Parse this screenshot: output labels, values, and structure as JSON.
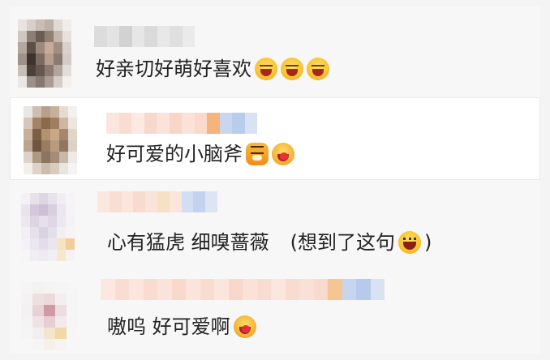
{
  "comments": [
    {
      "text": "好亲切好萌好喜欢",
      "emojis": [
        "laugh-cry-emoji",
        "laugh-cry-emoji",
        "laugh-cry-emoji"
      ],
      "highlighted": false
    },
    {
      "text": "好可爱的小脑斧",
      "emojis": [
        "tiger-emoji",
        "hug-emoji"
      ],
      "highlighted": true
    },
    {
      "text": "心有猛虎 细嗅蔷薇",
      "paren_open": "(",
      "paren_text": "想到了这句",
      "paren_close": ")",
      "emojis": [
        "grin-emoji"
      ],
      "highlighted": false
    },
    {
      "text": "嗷呜 好可爱啊",
      "emojis": [
        "hug-emoji"
      ],
      "highlighted": false
    }
  ],
  "colors": {
    "background": "#f7f7f7",
    "highlight": "#ffffff",
    "text": "#222222"
  }
}
